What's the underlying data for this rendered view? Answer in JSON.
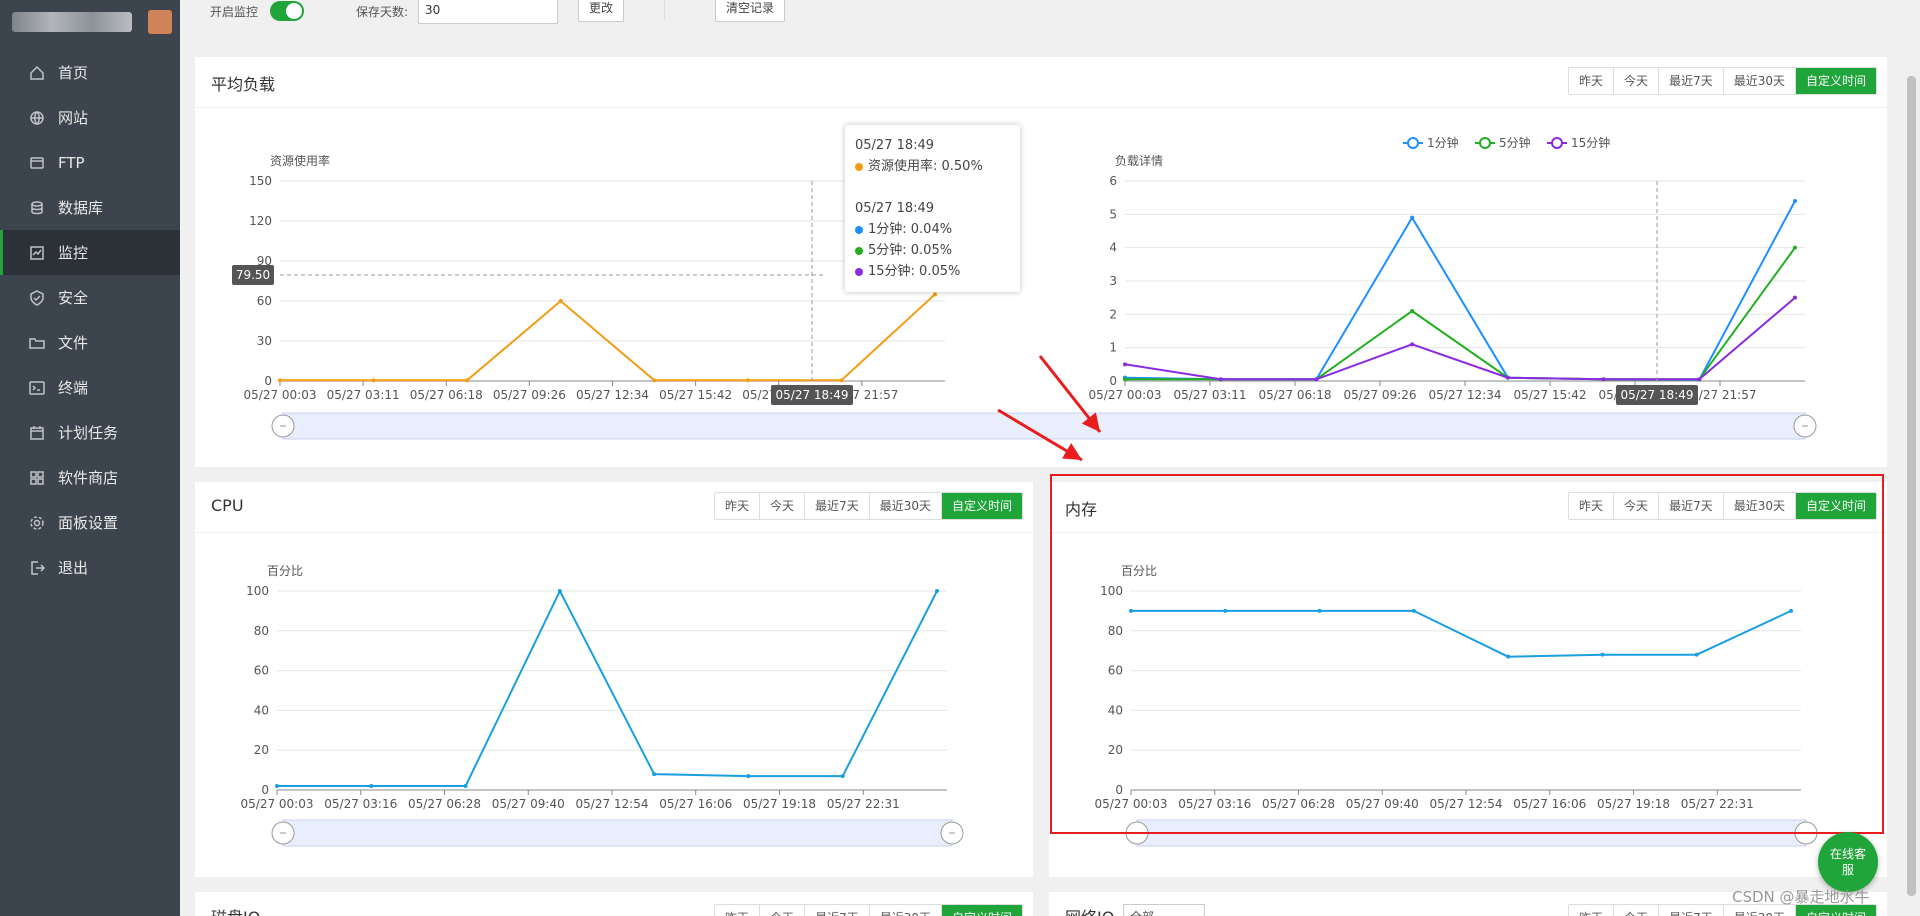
{
  "sidebar": {
    "items": [
      {
        "label": "首页",
        "icon": "home-icon"
      },
      {
        "label": "网站",
        "icon": "globe-icon"
      },
      {
        "label": "FTP",
        "icon": "ftp-icon"
      },
      {
        "label": "数据库",
        "icon": "database-icon"
      },
      {
        "label": "监控",
        "icon": "monitor-icon",
        "active": true
      },
      {
        "label": "安全",
        "icon": "shield-icon"
      },
      {
        "label": "文件",
        "icon": "folder-icon"
      },
      {
        "label": "终端",
        "icon": "terminal-icon"
      },
      {
        "label": "计划任务",
        "icon": "calendar-icon"
      },
      {
        "label": "软件商店",
        "icon": "apps-icon"
      },
      {
        "label": "面板设置",
        "icon": "gear-icon"
      },
      {
        "label": "退出",
        "icon": "logout-icon"
      }
    ]
  },
  "toolbar": {
    "monitor_label": "开启监控",
    "retention_label": "保存天数:",
    "retention_value": "30",
    "change_button": "更改",
    "clear_button": "清空记录"
  },
  "range_buttons": [
    "昨天",
    "今天",
    "最近7天",
    "最近30天",
    "自定义时间"
  ],
  "load_card": {
    "title": "平均负载",
    "left": {
      "ylabel": "资源使用率",
      "yticks": [
        "0",
        "30",
        "60",
        "90",
        "120",
        "150"
      ],
      "xticks": [
        "05/27 00:03",
        "05/27 03:11",
        "05/27 06:18",
        "05/27 09:26",
        "05/27 12:34",
        "05/27 15:42",
        "05/27 18:49",
        "05/27 21:57"
      ],
      "pointer_y_label": "79.50",
      "pointer_x_label": "05/27 18:49"
    },
    "right": {
      "ylabel": "负载详情",
      "yticks": [
        "0",
        "1",
        "2",
        "3",
        "4",
        "5",
        "6"
      ],
      "xticks": [
        "05/27 00:03",
        "05/27 03:11",
        "05/27 06:18",
        "05/27 09:26",
        "05/27 12:34",
        "05/27 15:42",
        "05/27 18:49",
        "05/27 21:57"
      ],
      "pointer_x_label": "05/27 18:49",
      "legend": [
        "1分钟",
        "5分钟",
        "15分钟"
      ]
    },
    "tooltip": {
      "time1": "05/27 18:49",
      "usage": "资源使用率: 0.50%",
      "time2": "05/27 18:49",
      "m1": "1分钟: 0.04%",
      "m5": "5分钟: 0.05%",
      "m15": "15分钟: 0.05%"
    }
  },
  "cpu_card": {
    "title": "CPU",
    "ylabel": "百分比",
    "yticks": [
      "0",
      "20",
      "40",
      "60",
      "80",
      "100"
    ],
    "xticks": [
      "05/27 00:03",
      "05/27 03:16",
      "05/27 06:28",
      "05/27 09:40",
      "05/27 12:54",
      "05/27 16:06",
      "05/27 19:18",
      "05/27 22:31"
    ]
  },
  "mem_card": {
    "title": "内存",
    "ylabel": "百分比",
    "yticks": [
      "0",
      "20",
      "40",
      "60",
      "80",
      "100"
    ],
    "xticks": [
      "05/27 00:03",
      "05/27 03:16",
      "05/27 06:28",
      "05/27 09:40",
      "05/27 12:54",
      "05/27 16:06",
      "05/27 19:18",
      "05/27 22:31"
    ]
  },
  "bottom_cards": {
    "disk_title": "磁盘IO",
    "net_title": "网络IO",
    "net_select": "全部"
  },
  "float_button": "在线客服",
  "watermark": "CSDN @暴走地水牛",
  "colors": {
    "accent": "#20a53a",
    "load": "#f39c12",
    "m1": "#1e90ff",
    "m5": "#20b020",
    "m15": "#8a2be2",
    "line": "#1a9fe0",
    "red": "#e81e1e"
  },
  "chart_data": [
    {
      "type": "line",
      "title": "",
      "ylabel": "资源使用率",
      "ylim": [
        0,
        150
      ],
      "x": [
        "05/27 00:03",
        "05/27 03:11",
        "05/27 06:18",
        "05/27 09:26",
        "05/27 12:34",
        "05/27 15:42",
        "05/27 18:49",
        "05/27 21:57"
      ],
      "series": [
        {
          "name": "资源使用率",
          "values": [
            0.5,
            0.5,
            0.5,
            60,
            0.5,
            0.5,
            0.5,
            65
          ]
        }
      ]
    },
    {
      "type": "line",
      "title": "",
      "ylabel": "负载详情",
      "ylim": [
        0,
        6
      ],
      "x": [
        "05/27 00:03",
        "05/27 03:11",
        "05/27 06:18",
        "05/27 09:26",
        "05/27 12:34",
        "05/27 15:42",
        "05/27 18:49",
        "05/27 21:57"
      ],
      "series": [
        {
          "name": "1分钟",
          "values": [
            0.1,
            0.05,
            0.05,
            4.9,
            0.1,
            0.05,
            0.04,
            5.4
          ]
        },
        {
          "name": "5分钟",
          "values": [
            0.05,
            0.05,
            0.05,
            2.1,
            0.1,
            0.05,
            0.05,
            4.0
          ]
        },
        {
          "name": "15分钟",
          "values": [
            0.5,
            0.05,
            0.05,
            1.1,
            0.1,
            0.05,
            0.05,
            2.5
          ]
        }
      ]
    },
    {
      "type": "line",
      "title": "",
      "ylabel": "百分比",
      "ylim": [
        0,
        100
      ],
      "x": [
        "05/27 00:03",
        "05/27 03:16",
        "05/27 06:28",
        "05/27 09:40",
        "05/27 12:54",
        "05/27 16:06",
        "05/27 19:18",
        "05/27 22:31"
      ],
      "series": [
        {
          "name": "CPU",
          "values": [
            2,
            2,
            2,
            100,
            8,
            7,
            7,
            100
          ]
        }
      ]
    },
    {
      "type": "line",
      "title": "",
      "ylabel": "百分比",
      "ylim": [
        0,
        100
      ],
      "x": [
        "05/27 00:03",
        "05/27 03:16",
        "05/27 06:28",
        "05/27 09:40",
        "05/27 12:54",
        "05/27 16:06",
        "05/27 19:18",
        "05/27 22:31"
      ],
      "series": [
        {
          "name": "内存",
          "values": [
            90,
            90,
            90,
            90,
            67,
            68,
            68,
            90
          ]
        }
      ]
    }
  ]
}
